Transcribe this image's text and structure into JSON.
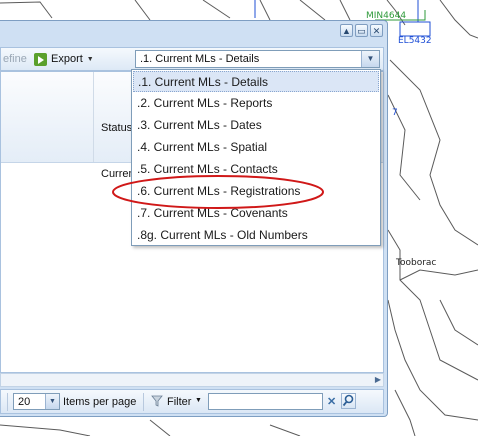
{
  "map": {
    "labels": {
      "min": "MIN4644",
      "el": "EL5432",
      "blue_fragment": "7",
      "town": "Tooborac"
    }
  },
  "toolbar": {
    "refine_label": "efine",
    "export_label": "Export",
    "view_select_value": ".1. Current MLs - Details"
  },
  "grid": {
    "header_status": "Status",
    "first_row_status": "Current"
  },
  "dropdown": {
    "items": [
      ".1. Current MLs - Details",
      ".2. Current MLs - Reports",
      ".3. Current MLs - Dates",
      ".4. Current MLs - Spatial",
      ".5. Current MLs - Contacts",
      ".6. Current MLs - Registrations",
      ".7. Current MLs - Covenants",
      ".8g. Current MLs - Old Numbers"
    ],
    "selected_index": 0,
    "highlighted_index": 5
  },
  "pager": {
    "page_size": "20",
    "items_per_page_label": "Items per page",
    "filter_label": "Filter",
    "filter_value": ""
  },
  "colors": {
    "panel": "#cfe0f3",
    "annotation_red": "#d01818",
    "map_road": "#555555",
    "map_blue": "#1f4fd6",
    "map_green": "#2e9a3a"
  },
  "icons": {
    "export": "export-icon",
    "filter": "funnel-icon",
    "clear": "clear-x-icon",
    "search": "search-icon",
    "dropdown": "chevron-down-icon"
  }
}
